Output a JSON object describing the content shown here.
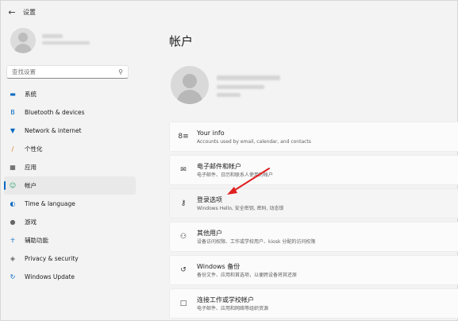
{
  "titlebar": {
    "back_icon": "arrow-left-icon",
    "title": "设置"
  },
  "search": {
    "placeholder": "查找设置"
  },
  "sidebar": {
    "items": [
      {
        "label": "系统",
        "icon": "monitor-icon",
        "color": "#0067c0",
        "active": false
      },
      {
        "label": "Bluetooth & devices",
        "icon": "bluetooth-icon",
        "color": "#0067c0",
        "active": false
      },
      {
        "label": "Network & internet",
        "icon": "wifi-icon",
        "color": "#0067c0",
        "active": false
      },
      {
        "label": "个性化",
        "icon": "brush-icon",
        "color": "#e07a1f",
        "active": false
      },
      {
        "label": "应用",
        "icon": "apps-icon",
        "color": "#444444",
        "active": false
      },
      {
        "label": "帐户",
        "icon": "person-icon",
        "color": "#2fa36b",
        "active": true
      },
      {
        "label": "Time & language",
        "icon": "globe-clock-icon",
        "color": "#0067c0",
        "active": false
      },
      {
        "label": "游戏",
        "icon": "gamepad-icon",
        "color": "#666666",
        "active": false
      },
      {
        "label": "辅助功能",
        "icon": "accessibility-icon",
        "color": "#0067c0",
        "active": false
      },
      {
        "label": "Privacy & security",
        "icon": "shield-icon",
        "color": "#666666",
        "active": false
      },
      {
        "label": "Windows Update",
        "icon": "update-icon",
        "color": "#0067c0",
        "active": false
      }
    ]
  },
  "main": {
    "title": "帐户",
    "cards": [
      {
        "title": "Your info",
        "desc": "Accounts used by email, calendar, and contacts",
        "icon": "person-info-icon"
      },
      {
        "title": "电子邮件和帐户",
        "desc": "电子邮件、日历和联系人使用的帐户",
        "icon": "mail-icon"
      },
      {
        "title": "登录选项",
        "desc": "Windows Hello, 安全密钥, 密码, 动态锁",
        "icon": "key-icon"
      },
      {
        "title": "其他用户",
        "desc": "设备访问权限、工作或学校用户、kiosk 分配的访问权限",
        "icon": "add-user-icon"
      },
      {
        "title": "Windows 备份",
        "desc": "备份文件、应用和首选项，以便跨设备将其还原",
        "icon": "backup-icon"
      },
      {
        "title": "连接工作或学校帐户",
        "desc": "电子邮件、应用和网络等组织资源",
        "icon": "briefcase-icon"
      }
    ]
  },
  "colors": {
    "accent": "#0067c0",
    "arrow": "#e02020"
  }
}
